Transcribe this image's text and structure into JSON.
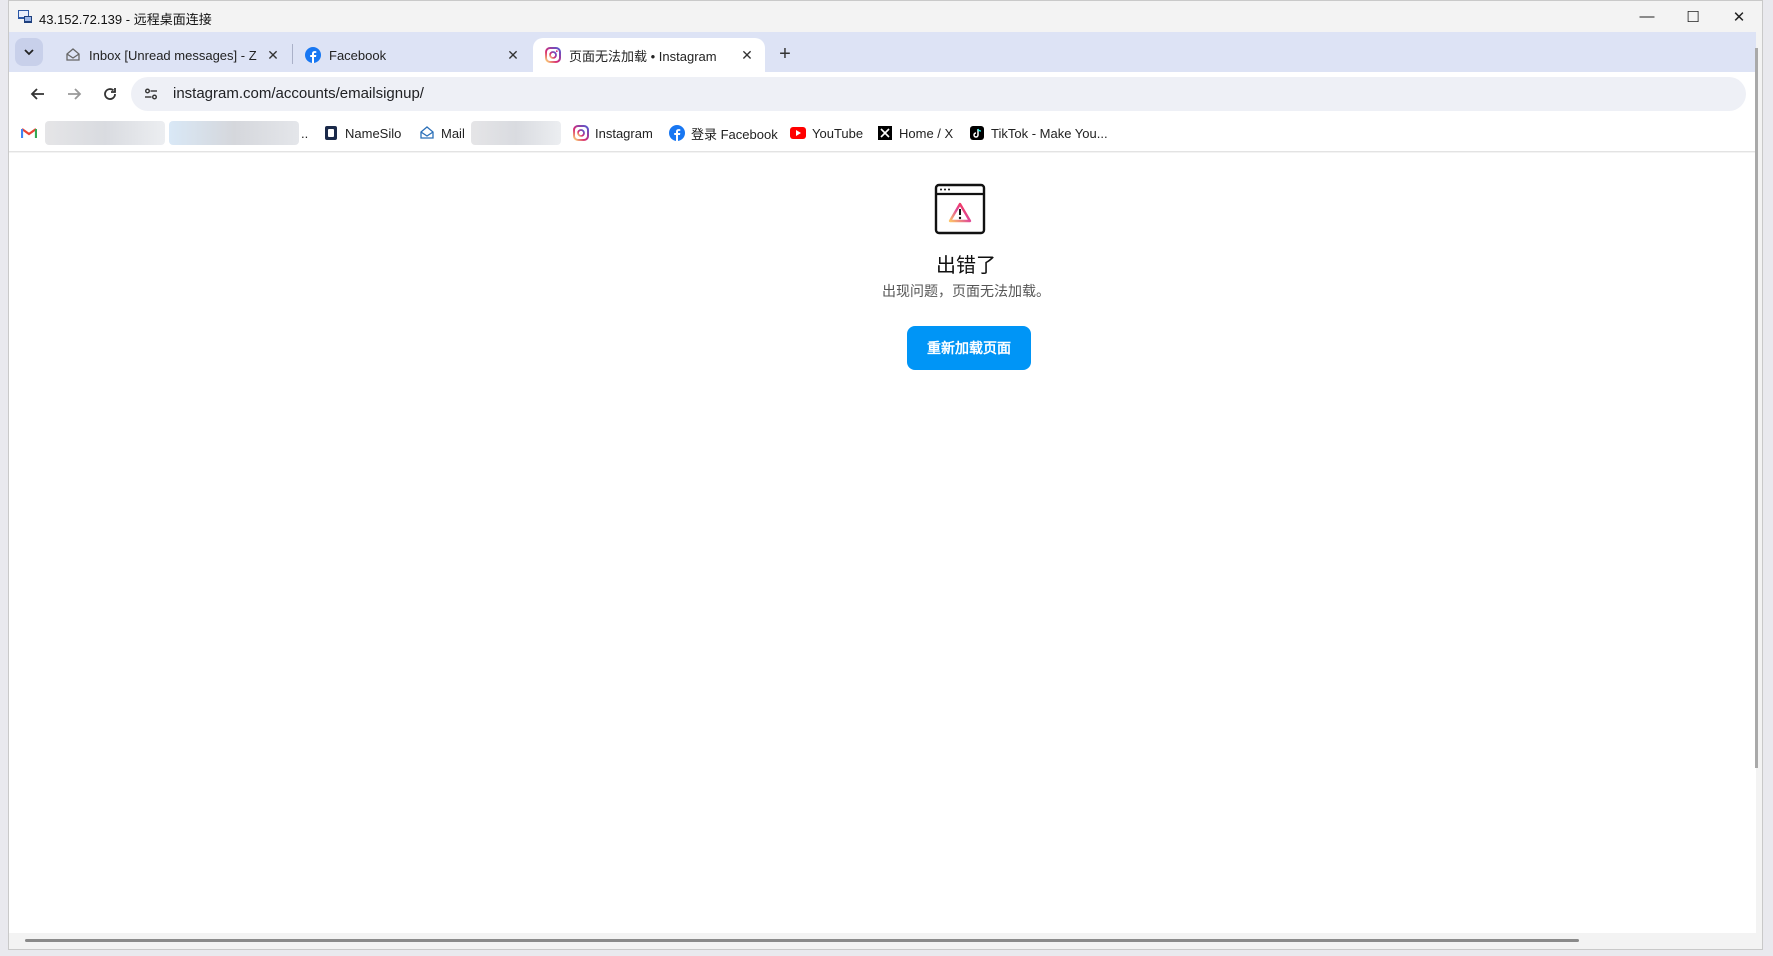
{
  "remote_desktop": {
    "title": "43.152.72.139 - 远程桌面连接",
    "controls": {
      "minimize": "—",
      "maximize": "☐",
      "close": "✕"
    }
  },
  "tabs": [
    {
      "label": "Inbox [Unread messages] - Z",
      "icon": "mail-icon",
      "active": false
    },
    {
      "label": "Facebook",
      "icon": "facebook-icon",
      "active": false
    },
    {
      "label": "页面无法加载 • Instagram",
      "icon": "instagram-icon",
      "active": true
    }
  ],
  "toolbar": {
    "url": "instagram.com/accounts/emailsignup/"
  },
  "bookmarks": [
    {
      "label": "..",
      "icon": "gmail-icon"
    },
    {
      "label": "NameSilo",
      "icon": "namesilo-icon"
    },
    {
      "label": "Mail",
      "icon": "mail-icon"
    },
    {
      "label": "Instagram",
      "icon": "instagram-icon"
    },
    {
      "label": "登录 Facebook",
      "icon": "facebook-icon"
    },
    {
      "label": "YouTube",
      "icon": "youtube-icon"
    },
    {
      "label": "Home / X",
      "icon": "x-icon"
    },
    {
      "label": "TikTok - Make You...",
      "icon": "tiktok-icon"
    }
  ],
  "error_page": {
    "title": "出错了",
    "message": "出现问题，页面无法加载。",
    "button_label": "重新加载页面"
  },
  "colors": {
    "accent": "#0095f6",
    "tabstrip": "#dde3f5",
    "active_tab": "#ffffff"
  }
}
